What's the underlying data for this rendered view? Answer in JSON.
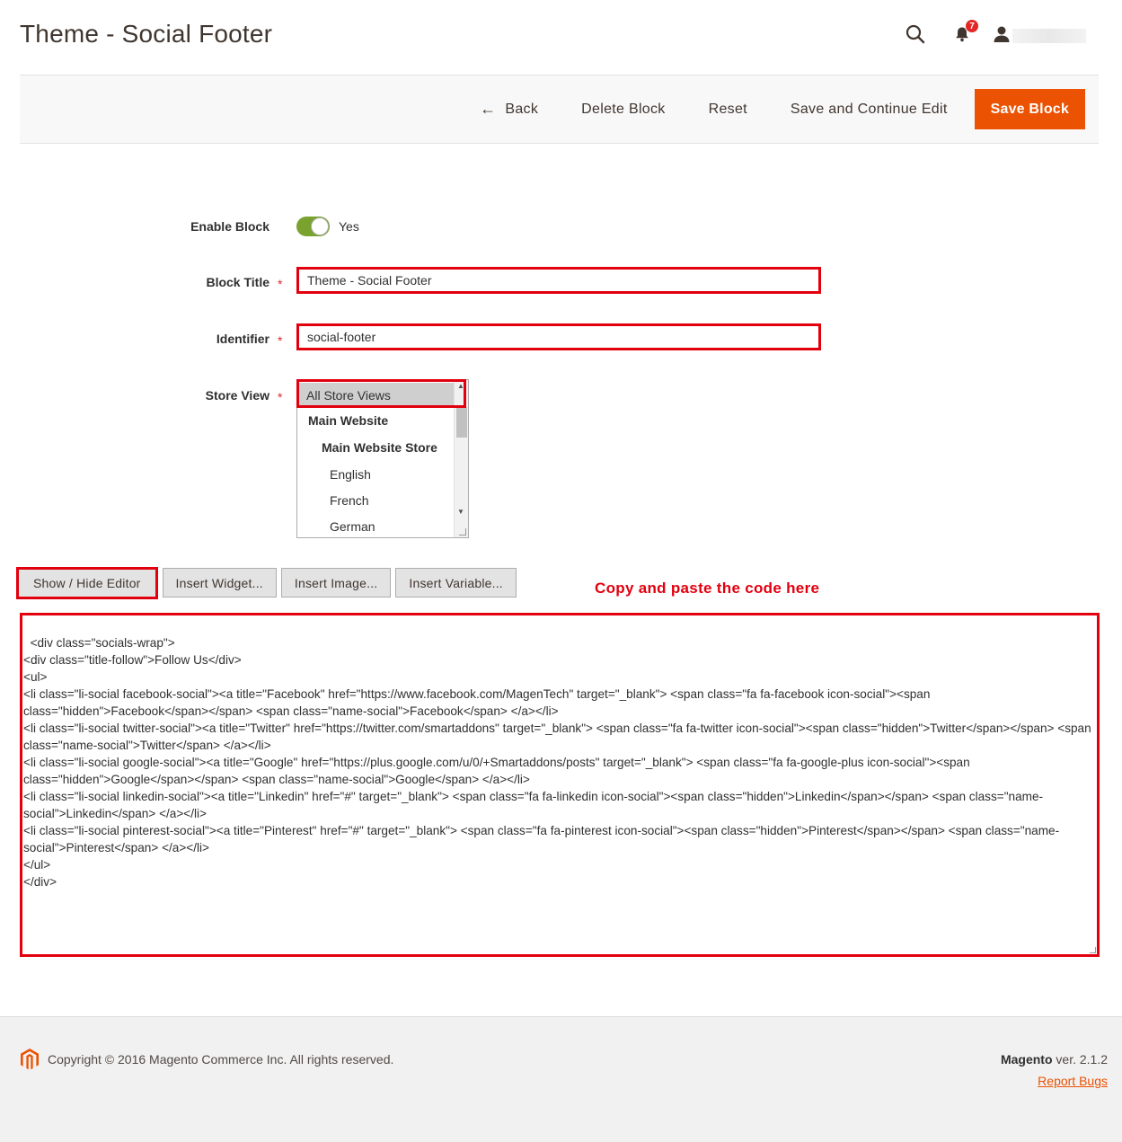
{
  "page": {
    "title": "Theme - Social Footer"
  },
  "header": {
    "notifications_count": "7",
    "icons": [
      "search-icon",
      "bell-icon",
      "user-icon"
    ]
  },
  "actions": {
    "back_label": "Back",
    "delete_label": "Delete Block",
    "reset_label": "Reset",
    "save_continue_label": "Save and Continue Edit",
    "save_label": "Save Block"
  },
  "form": {
    "enable_block": {
      "label": "Enable Block",
      "value": "Yes",
      "on": true
    },
    "block_title": {
      "label": "Block Title",
      "required_mark": "*",
      "value": "Theme - Social Footer"
    },
    "identifier": {
      "label": "Identifier",
      "required_mark": "*",
      "value": "social-footer"
    },
    "store_view": {
      "label": "Store View",
      "required_mark": "*",
      "options": [
        "All Store Views",
        "Main Website",
        "Main Website Store",
        "English",
        "French",
        "German"
      ],
      "selected": "All Store Views"
    }
  },
  "editor": {
    "show_hide_label": "Show / Hide Editor",
    "insert_widget_label": "Insert Widget...",
    "insert_image_label": "Insert Image...",
    "insert_variable_label": "Insert Variable...",
    "annotation": "Copy and paste the code here",
    "content": "<div class=\"socials-wrap\">\n<div class=\"title-follow\">Follow Us</div>\n<ul>\n<li class=\"li-social facebook-social\"><a title=\"Facebook\" href=\"https://www.facebook.com/MagenTech\" target=\"_blank\"> <span class=\"fa fa-facebook icon-social\"><span class=\"hidden\">Facebook</span></span> <span class=\"name-social\">Facebook</span> </a></li>\n<li class=\"li-social twitter-social\"><a title=\"Twitter\" href=\"https://twitter.com/smartaddons\" target=\"_blank\"> <span class=\"fa fa-twitter icon-social\"><span class=\"hidden\">Twitter</span></span> <span class=\"name-social\">Twitter</span> </a></li>\n<li class=\"li-social google-social\"><a title=\"Google\" href=\"https://plus.google.com/u/0/+Smartaddons/posts\" target=\"_blank\"> <span class=\"fa fa-google-plus icon-social\"><span class=\"hidden\">Google</span></span> <span class=\"name-social\">Google</span> </a></li>\n<li class=\"li-social linkedin-social\"><a title=\"Linkedin\" href=\"#\" target=\"_blank\"> <span class=\"fa fa-linkedin icon-social\"><span class=\"hidden\">Linkedin</span></span> <span class=\"name-social\">Linkedin</span> </a></li>\n<li class=\"li-social pinterest-social\"><a title=\"Pinterest\" href=\"#\" target=\"_blank\"> <span class=\"fa fa-pinterest icon-social\"><span class=\"hidden\">Pinterest</span></span> <span class=\"name-social\">Pinterest</span> </a></li>\n</ul>\n</div>"
  },
  "footer": {
    "copyright": "Copyright © 2016 Magento Commerce Inc. All rights reserved.",
    "brand": "Magento",
    "version": "ver. 2.1.2",
    "report_bugs": "Report Bugs"
  },
  "colors": {
    "accent": "#eb5202",
    "highlight": "#e2000f",
    "toggle_on": "#79a22e"
  }
}
